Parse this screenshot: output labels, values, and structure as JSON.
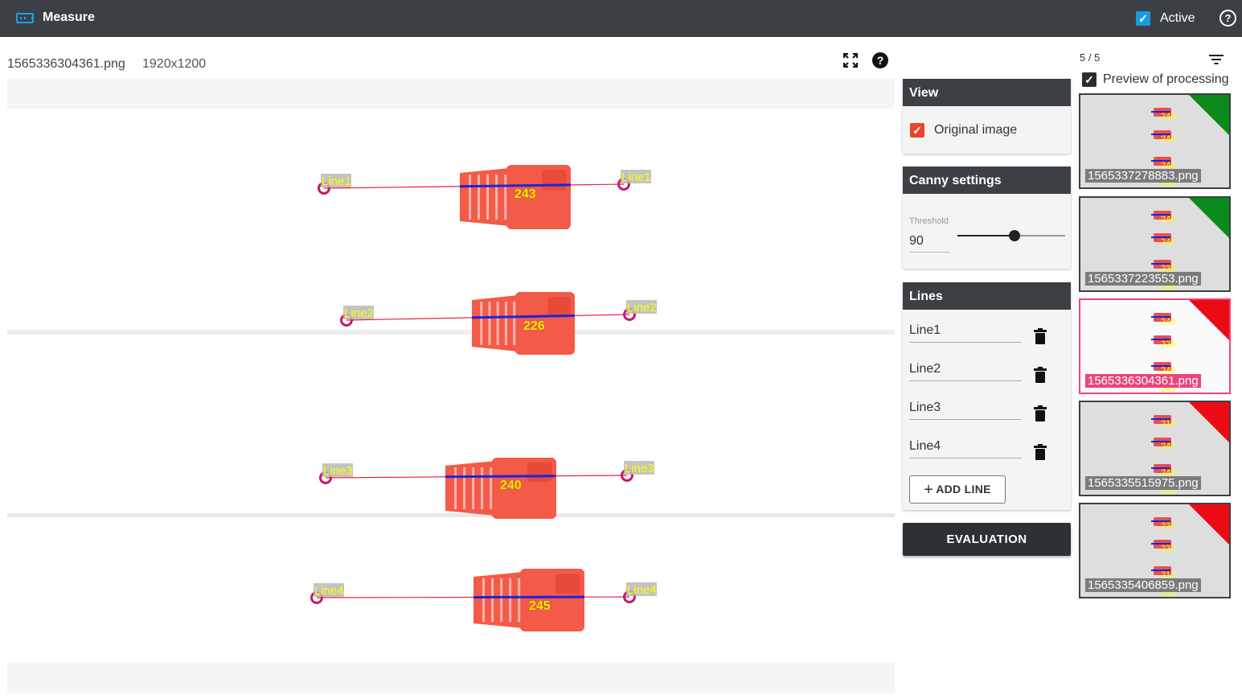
{
  "header": {
    "app_title": "Measure",
    "active_label": "Active",
    "active_checked": true
  },
  "image": {
    "file_name": "1565336304361.png",
    "resolution": "1920x1200"
  },
  "canvas": {
    "lines": [
      {
        "label": "Line1",
        "value": "243"
      },
      {
        "label": "Line2",
        "value": "226"
      },
      {
        "label": "Line3",
        "value": "240"
      },
      {
        "label": "Line4",
        "value": "245"
      }
    ],
    "colors": {
      "line": "#e8213a",
      "measure": "#1a24e0",
      "label_bg": "#b9b9b9",
      "label_text": "#ffff00",
      "part": "#f35a48",
      "marker": "#c8196a"
    }
  },
  "view_panel": {
    "title": "View",
    "original_image_label": "Original image",
    "original_image_checked": true
  },
  "canny_panel": {
    "title": "Canny settings",
    "threshold_label": "Threshold",
    "threshold_value": "90",
    "threshold_min": 0,
    "threshold_max": 255,
    "threshold_position": 0.53
  },
  "lines_panel": {
    "title": "Lines",
    "items": [
      {
        "name": "Line1"
      },
      {
        "name": "Line2"
      },
      {
        "name": "Line3"
      },
      {
        "name": "Line4"
      }
    ],
    "add_label": "ADD LINE"
  },
  "evaluation_label": "EVALUATION",
  "gallery": {
    "counter": "5 / 5",
    "preview_label": "Preview of processing",
    "preview_checked": true,
    "items": [
      {
        "name": "1565337278883.png",
        "status": "ok",
        "values": [
          "243",
          "244",
          "240",
          "242"
        ],
        "selected": false
      },
      {
        "name": "1565337223553.png",
        "status": "ok",
        "values": [
          "240",
          "242",
          "239",
          "239"
        ],
        "selected": false
      },
      {
        "name": "1565336304361.png",
        "status": "fail",
        "values": [
          "243",
          "226",
          "240",
          "245"
        ],
        "selected": true
      },
      {
        "name": "1565335515975.png",
        "status": "fail",
        "values": [
          "215",
          "247",
          "244",
          "233"
        ],
        "selected": false
      },
      {
        "name": "1565335406859.png",
        "status": "fail",
        "values": [
          "231",
          "237",
          "217",
          "233"
        ],
        "selected": false
      }
    ],
    "status_colors": {
      "ok": "#0a8a1a",
      "fail": "#ee0a14"
    }
  }
}
